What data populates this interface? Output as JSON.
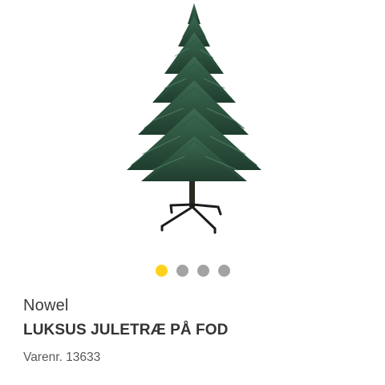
{
  "product": {
    "brand": "Nowel",
    "title": "LUKSUS JULETRÆ PÅ FOD",
    "sku": "Varenr. 13633",
    "image_icon": "christmas-tree-image"
  },
  "carousel": {
    "count": 4,
    "active_index": 0,
    "active_color": "#ffd21a",
    "inactive_color": "#a3a3a3"
  }
}
